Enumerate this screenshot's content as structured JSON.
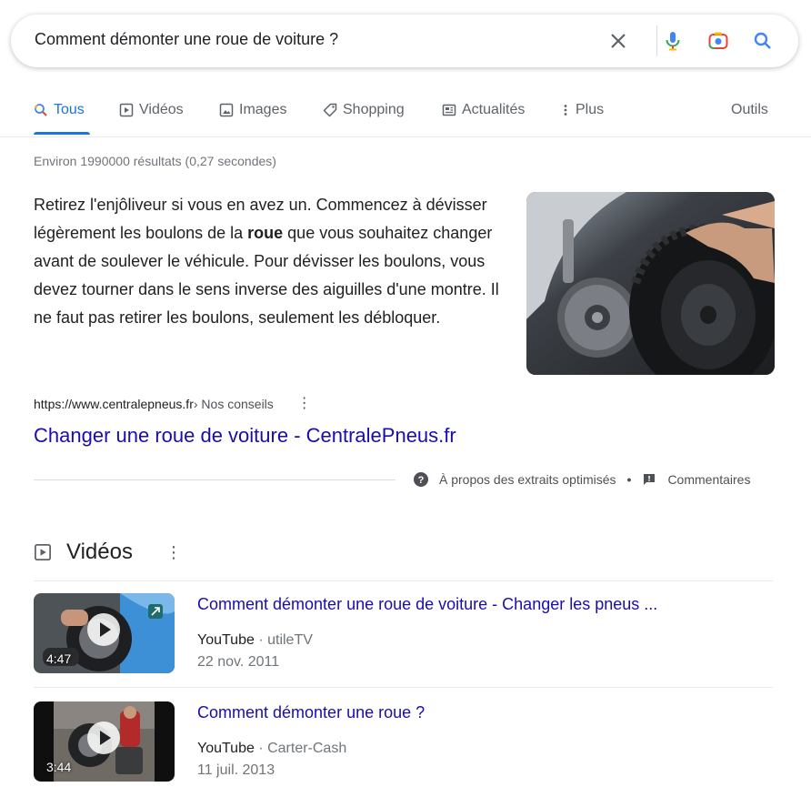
{
  "search": {
    "query": "Comment démonter une roue de voiture ?"
  },
  "tabs": [
    {
      "label": "Tous"
    },
    {
      "label": "Vidéos"
    },
    {
      "label": "Images"
    },
    {
      "label": "Shopping"
    },
    {
      "label": "Actualités"
    },
    {
      "label": "Plus"
    }
  ],
  "tools_label": "Outils",
  "stats": "Environ 1990000 résultats (0,27 secondes)",
  "snippet": {
    "text_before": "Retirez l'enjôliveur si vous en avez un. Commencez à dévisser légèrement les boulons de la ",
    "bold": "roue",
    "text_after": " que vous souhaitez changer avant de soulever le véhicule. Pour dévisser les boulons, vous devez tourner dans le sens inverse des aiguilles d'une montre. Il ne faut pas retirer les boulons, seulement les débloquer.",
    "url": "https://www.centralepneus.fr",
    "breadcrumb": " › Nos conseils",
    "title": "Changer une roue de voiture - CentralePneus.fr",
    "about_label": "À propos des extraits optimisés",
    "feedback_label": "Commentaires"
  },
  "videos_section": {
    "heading": "Vidéos",
    "items": [
      {
        "title": "Comment démonter une roue de voiture - Changer les pneus ...",
        "source": "YouTube",
        "channel": " · utileTV",
        "date": "22 nov. 2011",
        "duration": "4:47"
      },
      {
        "title": "Comment démonter une roue ?",
        "source": "YouTube",
        "channel": " · Carter-Cash",
        "date": "11 juil. 2013",
        "duration": "3:44"
      }
    ]
  },
  "colors": {
    "link": "#1a0dab",
    "accent": "#1a73e8",
    "text": "#202124",
    "muted": "#70757a"
  }
}
